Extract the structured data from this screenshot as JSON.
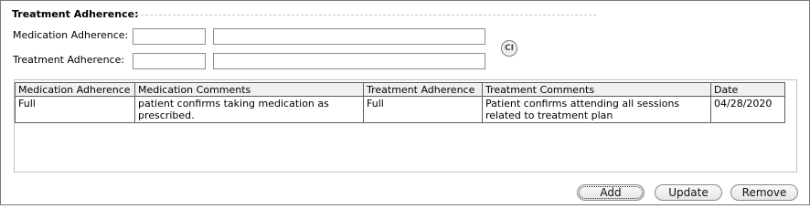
{
  "section": {
    "title": "Treatment Adherence:"
  },
  "form": {
    "medication_label": "Medication Adherence:",
    "medication_value": "",
    "medication_comment": "",
    "treatment_label": "Treatment Adherence:",
    "treatment_value": "",
    "treatment_comment": "",
    "ci_label": "CI"
  },
  "table": {
    "columns": [
      "Medication Adherence",
      "Medication Comments",
      "Treatment Adherence",
      "Treatment Comments",
      "Date"
    ],
    "rows": [
      [
        "Full",
        "patient confirms taking medication as prescribed.",
        "Full",
        "Patient confirms attending all sessions related to treatment plan",
        "04/28/2020"
      ]
    ]
  },
  "buttons": {
    "add": "Add",
    "update": "Update",
    "remove": "Remove"
  }
}
